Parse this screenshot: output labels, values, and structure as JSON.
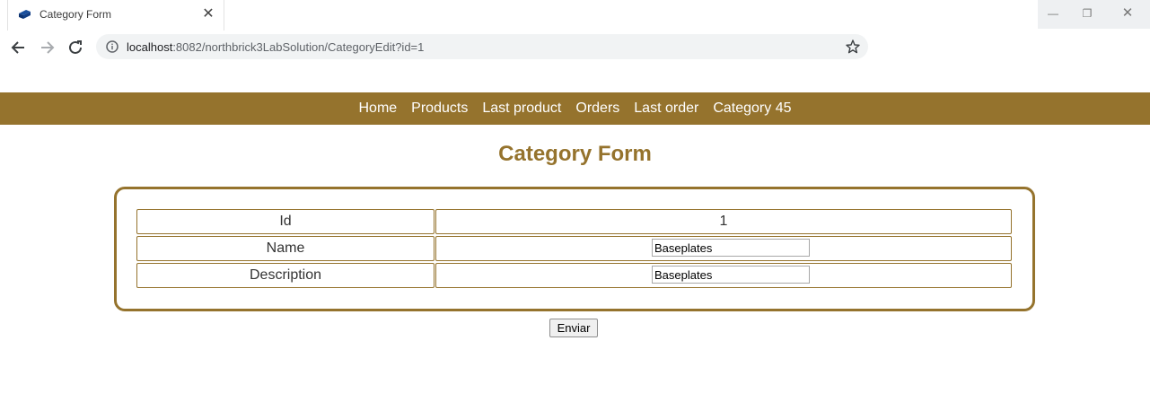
{
  "browser": {
    "tab_title": "Category Form",
    "url_host": "localhost",
    "url_rest": ":8082/northbrick3LabSolution/CategoryEdit?id=1"
  },
  "nav": {
    "items": [
      {
        "label": "Home"
      },
      {
        "label": "Products"
      },
      {
        "label": "Last product"
      },
      {
        "label": "Orders"
      },
      {
        "label": "Last order"
      },
      {
        "label": "Category 45"
      }
    ]
  },
  "page": {
    "title": "Category Form"
  },
  "form": {
    "id_label": "Id",
    "id_value": "1",
    "name_label": "Name",
    "name_value": "Baseplates",
    "description_label": "Description",
    "description_value": "Baseplates",
    "submit_label": "Enviar"
  },
  "colors": {
    "accent": "#95732d"
  }
}
